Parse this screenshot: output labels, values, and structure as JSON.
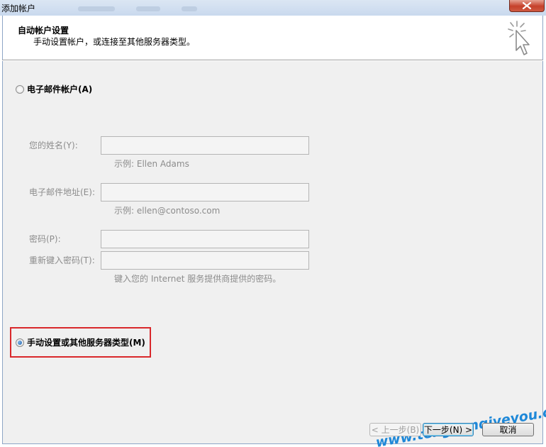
{
  "window": {
    "title": "添加帐户"
  },
  "header": {
    "title": "自动帐户设置",
    "subtitle": "手动设置帐户，或连接至其他服务器类型。"
  },
  "options": {
    "email_account": {
      "label": "电子邮件帐户(A)",
      "checked": false
    },
    "manual_setup": {
      "label": "手动设置或其他服务器类型(M)",
      "checked": true
    }
  },
  "form": {
    "name": {
      "label": "您的姓名(Y):",
      "value": "",
      "hint": "示例: Ellen Adams"
    },
    "email": {
      "label": "电子邮件地址(E):",
      "value": "",
      "hint": "示例: ellen@contoso.com"
    },
    "password": {
      "label": "密码(P):",
      "value": ""
    },
    "password_confirm": {
      "label": "重新键入密码(T):",
      "value": ""
    },
    "password_hint": "键入您的 Internet 服务提供商提供的密码。"
  },
  "buttons": {
    "back": "< 上一步(B)",
    "next": "下一步(N) >",
    "cancel": "取消"
  },
  "watermark": "www.tengxunqiyeyou.com",
  "colors": {
    "highlight": "#d9282b",
    "watermark": "#1e88d8",
    "disabled_text": "#8c8c8c"
  }
}
